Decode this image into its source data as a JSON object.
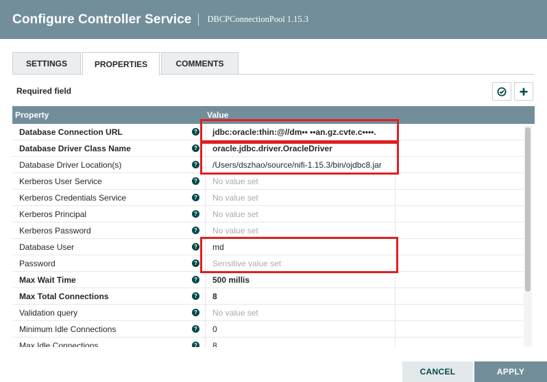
{
  "header": {
    "title": "Configure Controller Service",
    "subtitle": "DBCPConnectionPool 1.15.3"
  },
  "tabs": [
    {
      "label": "SETTINGS",
      "active": false
    },
    {
      "label": "PROPERTIES",
      "active": true
    },
    {
      "label": "COMMENTS",
      "active": false
    }
  ],
  "required_field": "Required field",
  "grid": {
    "col_property": "Property",
    "col_value": "Value",
    "rows": [
      {
        "name": "Database Connection URL",
        "required": true,
        "value": "jdbc:oracle:thin:@//dm••  ••an.gz.cvte.c••••.",
        "state": "set-bold"
      },
      {
        "name": "Database Driver Class Name",
        "required": true,
        "value": "oracle.jdbc.driver.OracleDriver",
        "state": "set-bold"
      },
      {
        "name": "Database Driver Location(s)",
        "required": false,
        "value": "/Users/dszhao/source/nifi-1.15.3/bin/ojdbc8.jar",
        "state": "set"
      },
      {
        "name": "Kerberos User Service",
        "required": false,
        "value": "No value set",
        "state": "unset"
      },
      {
        "name": "Kerberos Credentials Service",
        "required": false,
        "value": "No value set",
        "state": "unset"
      },
      {
        "name": "Kerberos Principal",
        "required": false,
        "value": "No value set",
        "state": "unset"
      },
      {
        "name": "Kerberos Password",
        "required": false,
        "value": "No value set",
        "state": "unset"
      },
      {
        "name": "Database User",
        "required": false,
        "value": "md",
        "state": "set"
      },
      {
        "name": "Password",
        "required": false,
        "value": "Sensitive value set",
        "state": "unset"
      },
      {
        "name": "Max Wait Time",
        "required": true,
        "value": "500 millis",
        "state": "set-bold"
      },
      {
        "name": "Max Total Connections",
        "required": true,
        "value": "8",
        "state": "set-bold"
      },
      {
        "name": "Validation query",
        "required": false,
        "value": "No value set",
        "state": "unset"
      },
      {
        "name": "Minimum Idle Connections",
        "required": false,
        "value": "0",
        "state": "set"
      },
      {
        "name": "Max Idle Connections",
        "required": false,
        "value": "8",
        "state": "set"
      }
    ]
  },
  "buttons": {
    "cancel": "CANCEL",
    "apply": "APPLY"
  },
  "icons": {
    "verify": "check-circle-icon",
    "add": "plus-icon",
    "help": "question-circle-icon"
  },
  "colors": {
    "header": "#728e9b",
    "accent": "#004849",
    "highlight": "#e01f1f"
  }
}
